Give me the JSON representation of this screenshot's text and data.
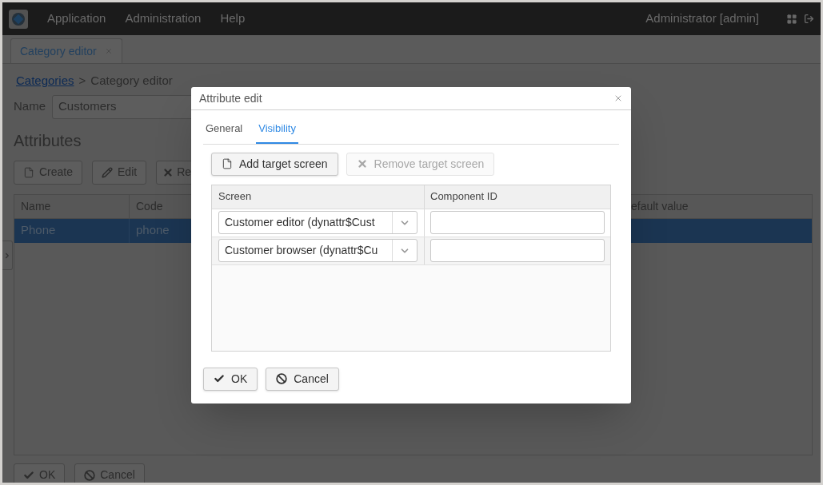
{
  "menu_bar": {
    "items": [
      "Application",
      "Administration",
      "Help"
    ],
    "user": "Administrator [admin]"
  },
  "tabs": [
    {
      "label": "Category editor",
      "selected": true
    }
  ],
  "breadcrumb": {
    "link": "Categories",
    "separator": ">",
    "current": "Category editor"
  },
  "name_field": {
    "label": "Name",
    "value": "Customers"
  },
  "attributes": {
    "title": "Attributes",
    "buttons": [
      {
        "label": "Create",
        "kind": "create"
      },
      {
        "label": "Edit",
        "kind": "edit"
      },
      {
        "label": "Re",
        "kind": "remove"
      }
    ],
    "columns": [
      "Name",
      "Code",
      "efault value"
    ],
    "rows": [
      {
        "cells": [
          "Phone",
          "phone"
        ],
        "selected": true
      }
    ]
  },
  "footer_buttons": [
    {
      "label": "OK",
      "kind": "ok"
    },
    {
      "label": "Cancel",
      "kind": "cancel"
    }
  ],
  "dialog": {
    "title": "Attribute edit",
    "tabs": [
      {
        "label": "General",
        "selected": false
      },
      {
        "label": "Visibility",
        "selected": true
      }
    ],
    "buttons": [
      {
        "label": "Add target screen",
        "kind": "add",
        "disabled": false
      },
      {
        "label": "Remove target screen",
        "kind": "remove",
        "disabled": true
      }
    ],
    "columns": [
      "Screen",
      "Component ID"
    ],
    "rows": [
      {
        "screen": "Customer editor (dynattr$Cust"
      },
      {
        "screen": "Customer browser (dynattr$Cu"
      }
    ],
    "footer_buttons": [
      {
        "label": "OK",
        "kind": "ok"
      },
      {
        "label": "Cancel",
        "kind": "cancel"
      }
    ]
  }
}
